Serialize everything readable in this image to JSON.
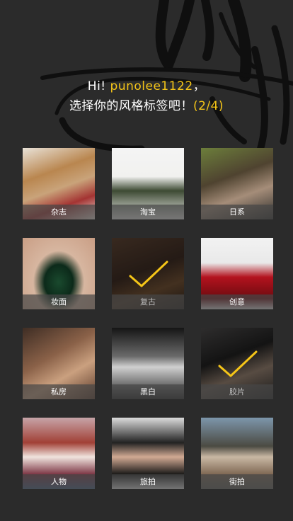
{
  "header": {
    "greeting": "Hi!",
    "username": "punolee1122",
    "comma": "，",
    "prompt": "选择你的风格标签吧！",
    "step": "(2/4)"
  },
  "colors": {
    "background": "#2b2b2b",
    "accent": "#f5c518",
    "text": "#ffffff"
  },
  "tags": [
    {
      "label": "杂志",
      "selected": false
    },
    {
      "label": "淘宝",
      "selected": false
    },
    {
      "label": "日系",
      "selected": false
    },
    {
      "label": "妆面",
      "selected": false
    },
    {
      "label": "复古",
      "selected": true
    },
    {
      "label": "创意",
      "selected": false
    },
    {
      "label": "私房",
      "selected": false
    },
    {
      "label": "黑白",
      "selected": false
    },
    {
      "label": "胶片",
      "selected": true
    },
    {
      "label": "人物",
      "selected": false
    },
    {
      "label": "旅拍",
      "selected": false
    },
    {
      "label": "街拍",
      "selected": false
    }
  ]
}
